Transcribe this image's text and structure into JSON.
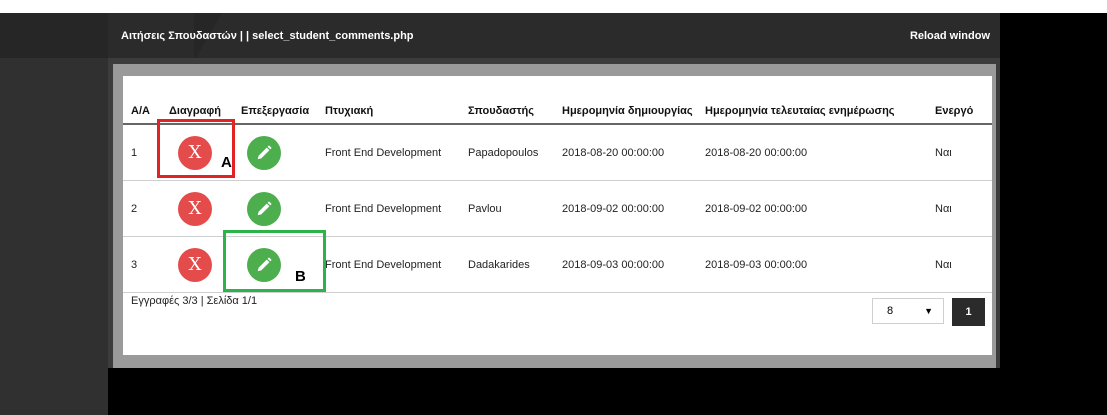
{
  "titlebar": {
    "title": "Αιτήσεις Σπουδαστών | | select_student_comments.php",
    "reload_label": "Reload window"
  },
  "table": {
    "headers": [
      "Α/Α",
      "Διαγραφή",
      "Επεξεργασία",
      "Πτυχιακή",
      "Σπουδαστής",
      "Ημερομηνία δημιουργίας",
      "Ημερομηνία τελευταίας ενημέρωσης",
      "Ενεργό"
    ],
    "rows": [
      {
        "aa": "1",
        "delete_icon": "X",
        "thesis": "Front End Development",
        "student": "Papadopoulos",
        "created": "2018-08-20 00:00:00",
        "updated": "2018-08-20 00:00:00",
        "active": "Ναι"
      },
      {
        "aa": "2",
        "delete_icon": "X",
        "thesis": "Front End Development",
        "student": "Pavlou",
        "created": "2018-09-02 00:00:00",
        "updated": "2018-09-02 00:00:00",
        "active": "Ναι"
      },
      {
        "aa": "3",
        "delete_icon": "X",
        "thesis": "Front End Development",
        "student": "Dadakarides",
        "created": "2018-09-03 00:00:00",
        "updated": "2018-09-03 00:00:00",
        "active": "Ναι"
      }
    ]
  },
  "footer": {
    "records_info": "Εγγραφές 3/3 | Σελίδα 1/1",
    "page_size": "8",
    "current_page": "1"
  },
  "annotations": {
    "a": "A",
    "b": "B"
  },
  "colors": {
    "delete": "#e44b4b",
    "edit": "#4cae4c",
    "annot_a": "#e02424",
    "annot_b": "#2db34a"
  },
  "icons": {
    "edit": "pencil-icon",
    "dropdown": "caret-down-icon"
  }
}
